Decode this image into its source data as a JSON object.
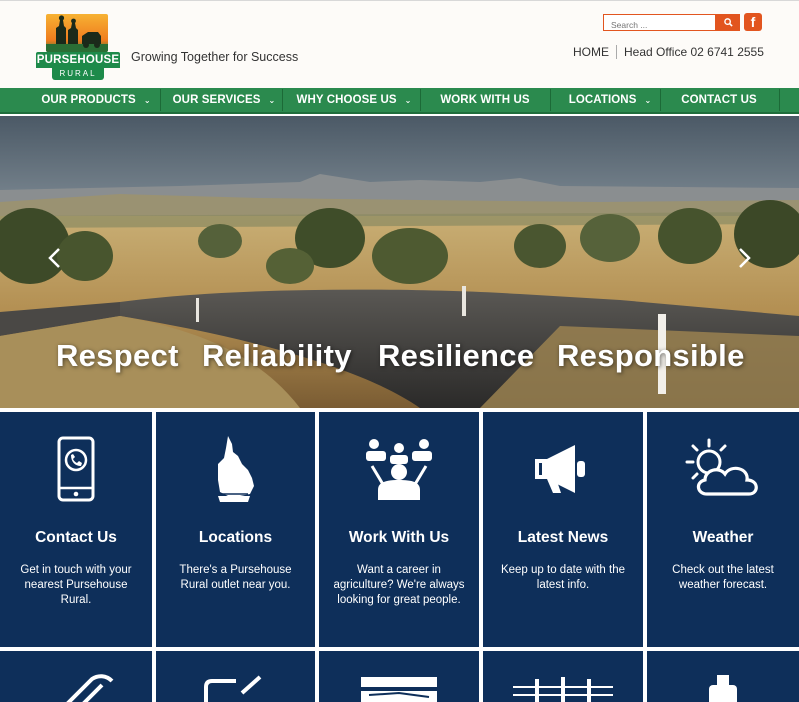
{
  "header": {
    "logo_name": "PURSEHOUSE",
    "logo_sub": "RURAL",
    "tagline": "Growing Together for Success",
    "search_placeholder": "Search ...",
    "facebook_label": "f",
    "home_link": "HOME",
    "head_office": "Head Office 02 6741 2555"
  },
  "nav": {
    "items": [
      {
        "label": "OUR PRODUCTS",
        "has_dropdown": true
      },
      {
        "label": "OUR SERVICES",
        "has_dropdown": true
      },
      {
        "label": "WHY CHOOSE US",
        "has_dropdown": true
      },
      {
        "label": "WORK WITH US",
        "has_dropdown": false
      },
      {
        "label": "LOCATIONS",
        "has_dropdown": true
      },
      {
        "label": "CONTACT US",
        "has_dropdown": false
      }
    ]
  },
  "hero": {
    "words": [
      "Respect",
      "Reliability",
      "Resilience",
      "Responsible"
    ]
  },
  "tiles": [
    {
      "icon": "phone-icon",
      "title": "Contact Us",
      "desc": "Get in touch with your nearest Pursehouse Rural."
    },
    {
      "icon": "queensland-map-icon",
      "title": "Locations",
      "desc": "There's a Pursehouse Rural outlet near you."
    },
    {
      "icon": "team-icon",
      "title": "Work With Us",
      "desc": "Want a career in agriculture? We're always looking for great people."
    },
    {
      "icon": "megaphone-icon",
      "title": "Latest News",
      "desc": "Keep up to date with the latest info."
    },
    {
      "icon": "weather-icon",
      "title": "Weather",
      "desc": "Check out the latest weather forecast."
    }
  ],
  "colors": {
    "green": "#2b8a4e",
    "navy": "#0e2f5a",
    "orange": "#e2551f"
  }
}
